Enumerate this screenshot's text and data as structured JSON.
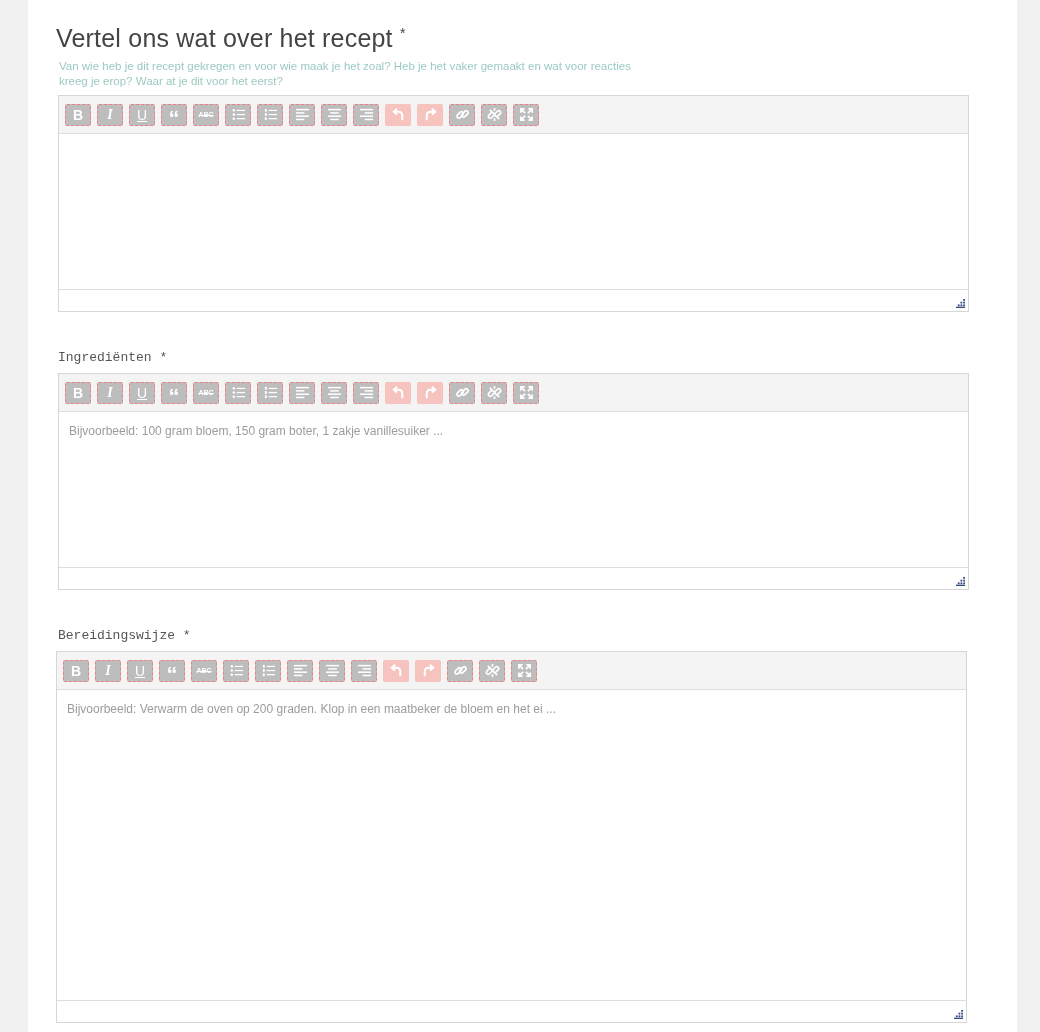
{
  "editors": [
    {
      "label": "Vertel ons wat over het recept",
      "kind": "heading",
      "required_mark": "*",
      "hint": "Van wie heb je dit recept gekregen en voor wie maak je het zoal? Heb je het vaker gemaakt en wat voor reacties kreeg je erop? Waar at je dit voor het eerst?",
      "toolbar": [
        {
          "kind": "bold",
          "text": "B",
          "disabled": false
        },
        {
          "kind": "italic",
          "text": "I",
          "disabled": false
        },
        {
          "kind": "underline",
          "text": "U",
          "disabled": false
        },
        {
          "kind": "quote",
          "text": "“",
          "disabled": false
        },
        {
          "kind": "strike",
          "text": "ABC",
          "disabled": false
        },
        {
          "kind": "bullets",
          "disabled": false
        },
        {
          "kind": "numbers",
          "disabled": false
        },
        {
          "kind": "align-left",
          "disabled": false
        },
        {
          "kind": "align-center",
          "disabled": false
        },
        {
          "kind": "align-right",
          "disabled": false
        },
        {
          "kind": "undo",
          "disabled": true
        },
        {
          "kind": "redo",
          "disabled": true
        },
        {
          "kind": "link",
          "disabled": false
        },
        {
          "kind": "unlink",
          "disabled": false
        },
        {
          "kind": "fullscreen",
          "disabled": false
        }
      ]
    },
    {
      "label": "Ingrediënten",
      "kind": "mono",
      "required_mark": "*",
      "placeholder": "Bijvoorbeeld: 100 gram bloem, 150 gram boter, 1 zakje vanillesuiker ...",
      "toolbar": [
        {
          "kind": "bold",
          "text": "B",
          "disabled": false
        },
        {
          "kind": "italic",
          "text": "I",
          "disabled": false
        },
        {
          "kind": "underline",
          "text": "U",
          "disabled": false
        },
        {
          "kind": "quote",
          "text": "“",
          "disabled": false
        },
        {
          "kind": "strike",
          "text": "ABC",
          "disabled": false
        },
        {
          "kind": "bullets",
          "disabled": false
        },
        {
          "kind": "numbers",
          "disabled": false
        },
        {
          "kind": "align-left",
          "disabled": false
        },
        {
          "kind": "align-center",
          "disabled": false
        },
        {
          "kind": "align-right",
          "disabled": false
        },
        {
          "kind": "undo",
          "disabled": true
        },
        {
          "kind": "redo",
          "disabled": true
        },
        {
          "kind": "link",
          "disabled": false
        },
        {
          "kind": "unlink",
          "disabled": false
        },
        {
          "kind": "fullscreen",
          "disabled": false
        }
      ]
    },
    {
      "label": "Bereidingswijze",
      "kind": "mono",
      "required_mark": "*",
      "placeholder": "Bijvoorbeeld: Verwarm de oven op 200 graden. Klop in een maatbeker de bloem en het ei ...",
      "toolbar": [
        {
          "kind": "bold",
          "text": "B",
          "disabled": false
        },
        {
          "kind": "italic",
          "text": "I",
          "disabled": false
        },
        {
          "kind": "underline",
          "text": "U",
          "disabled": false
        },
        {
          "kind": "quote",
          "text": "“",
          "disabled": false
        },
        {
          "kind": "strike",
          "text": "ABC",
          "disabled": false
        },
        {
          "kind": "bullets",
          "disabled": false
        },
        {
          "kind": "numbers",
          "disabled": false
        },
        {
          "kind": "align-left",
          "disabled": false
        },
        {
          "kind": "align-center",
          "disabled": false
        },
        {
          "kind": "align-right",
          "disabled": false
        },
        {
          "kind": "undo",
          "disabled": true
        },
        {
          "kind": "redo",
          "disabled": true
        },
        {
          "kind": "link",
          "disabled": false
        },
        {
          "kind": "unlink",
          "disabled": false
        },
        {
          "kind": "fullscreen",
          "disabled": false
        }
      ]
    }
  ]
}
